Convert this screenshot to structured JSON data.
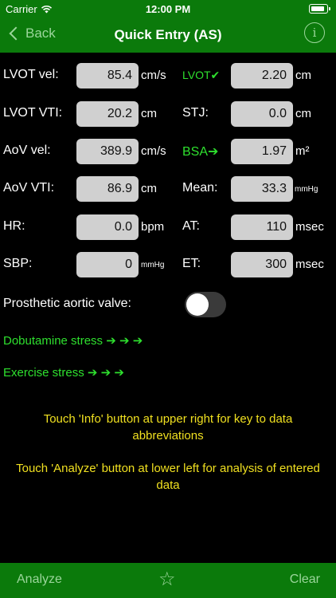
{
  "status": {
    "carrier": "Carrier",
    "time": "12:00 PM"
  },
  "nav": {
    "back_label": "Back",
    "title": "Quick Entry (AS)",
    "info_label": "i"
  },
  "rows": [
    {
      "left_label": "LVOT vel:",
      "left_value": "85.4",
      "left_unit": "cm/s",
      "right_label": "LVOT✔",
      "right_value": "2.20",
      "right_unit": "cm"
    },
    {
      "left_label": "LVOT VTI:",
      "left_value": "20.2",
      "left_unit": "cm",
      "right_label": "STJ:",
      "right_value": "0.0",
      "right_unit": "cm"
    },
    {
      "left_label": "AoV vel:",
      "left_value": "389.9",
      "left_unit": "cm/s",
      "right_label": "BSA➔",
      "right_value": "1.97",
      "right_unit": "m²"
    },
    {
      "left_label": "AoV VTI:",
      "left_value": "86.9",
      "left_unit": "cm",
      "right_label": "Mean:",
      "right_value": "33.3",
      "right_unit": "mmHg"
    },
    {
      "left_label": "HR:",
      "left_value": "0.0",
      "left_unit": "bpm",
      "right_label": "AT:",
      "right_value": "110",
      "right_unit": "msec"
    },
    {
      "left_label": "SBP:",
      "left_value": "0",
      "left_unit": "mmHg",
      "right_label": "ET:",
      "right_value": "300",
      "right_unit": "msec"
    }
  ],
  "prosthetic": {
    "label": "Prosthetic aortic valve:",
    "enabled": false
  },
  "links": {
    "dobutamine": "Dobutamine stress ➔ ➔ ➔",
    "exercise": "Exercise stress ➔ ➔ ➔"
  },
  "notes": {
    "info": "Touch 'Info' button at upper right for key to data abbreviations",
    "analyze": "Touch 'Analyze' button at lower left for analysis of entered data"
  },
  "footer": {
    "analyze_label": "Analyze",
    "star_label": "☆",
    "clear_label": "Clear"
  },
  "colors": {
    "bar": "#0b7a0b",
    "accent_green": "#2ee02e",
    "note_yellow": "#f0e020",
    "field_bg": "#d0d0d0"
  }
}
